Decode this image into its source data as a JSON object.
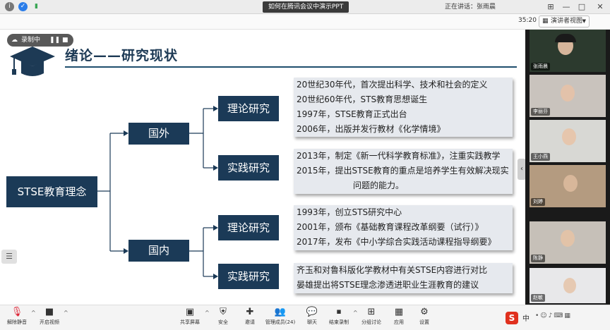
{
  "topbar": {
    "title": "如何在腾讯会议中演示PPT",
    "speaker": "正在讲话：张雨晨",
    "icons": [
      "info-icon",
      "shield-icon",
      "signal-icon"
    ],
    "window_controls": [
      "pin",
      "minimize",
      "maximize",
      "close"
    ]
  },
  "subbar": {
    "timer": "35:20",
    "view_label": "演讲者视图"
  },
  "recording": {
    "label": "录制中"
  },
  "slide": {
    "title": "绪论——研究现状",
    "root": "STSE教育理念",
    "foreign": {
      "label": "国外",
      "theory": {
        "label": "理论研究",
        "lines": [
          "20世纪30年代，首次提出科学、技术和社会的定义",
          "20世纪60年代，STS教育思想诞生",
          "1997年，STSE教育正式出台",
          "2006年，出版并发行教材《化学情境》"
        ]
      },
      "practice": {
        "label": "实践研究",
        "lines": [
          "2013年，制定《新一代科学教育标准》，注重实践教学",
          "2015年，提出STSE教育的重点是培养学生有效解决现实",
          "问题的能力。"
        ]
      }
    },
    "domestic": {
      "label": "国内",
      "theory": {
        "label": "理论研究",
        "lines": [
          "1993年，创立STS研究中心",
          "2001年，颁布《基础教育课程改革纲要（试行）》",
          "2017年，发布《中小学综合实践活动课程指导纲要》"
        ]
      },
      "practice": {
        "label": "实践研究",
        "lines": [
          "齐玉和对鲁科版化学教材中有关STSE内容进行对比",
          "晏雄提出将STSE理念渗透进职业生涯教育的建议"
        ]
      }
    }
  },
  "participants": [
    {
      "name": "张雨晨",
      "bg": "#2c3a2e"
    },
    {
      "name": "李丽芬",
      "bg": "#c9c3bd"
    },
    {
      "name": "王小燕",
      "bg": "#d8d8d4"
    },
    {
      "name": "刘婷",
      "bg": "#b49b80"
    },
    {
      "name": "陈静",
      "bg": "#c6c0b8"
    },
    {
      "name": "赵敏",
      "bg": "#e8e8ea"
    }
  ],
  "toolbar": {
    "buttons": [
      {
        "label": "解除静音",
        "icon": "mic-muted-icon"
      },
      {
        "label": "开启视频",
        "icon": "camera-icon"
      },
      {
        "label": "共享屏幕",
        "icon": "share-screen-icon"
      },
      {
        "label": "安全",
        "icon": "shield-icon"
      },
      {
        "label": "邀请",
        "icon": "invite-icon"
      },
      {
        "label": "管理成员(24)",
        "icon": "members-icon"
      },
      {
        "label": "聊天",
        "icon": "chat-icon"
      },
      {
        "label": "结束录制",
        "icon": "record-stop-icon"
      },
      {
        "label": "分组讨论",
        "icon": "breakout-icon"
      },
      {
        "label": "应用",
        "icon": "apps-icon"
      },
      {
        "label": "设置",
        "icon": "gear-icon"
      }
    ],
    "ime_label": "中"
  },
  "colors": {
    "box": "#1b3a57",
    "title": "#1d3a55",
    "bubble": "#e6e9ee",
    "accent_red": "#e0301e"
  }
}
